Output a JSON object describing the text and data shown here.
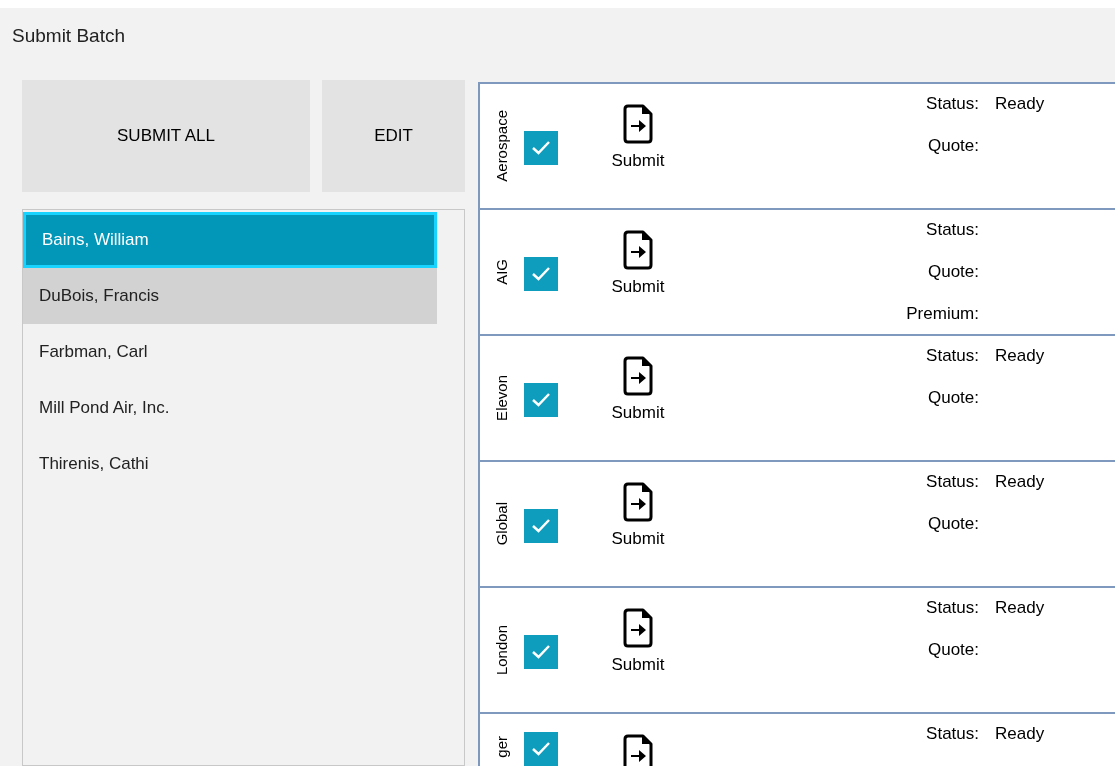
{
  "window": {
    "title": "Submit Batch"
  },
  "buttons": [
    {
      "label": "SUBMIT ALL"
    },
    {
      "label": "EDIT"
    }
  ],
  "clients": [
    {
      "name": "Bains, William",
      "selected": true,
      "hovered": false
    },
    {
      "name": "DuBois, Francis",
      "selected": false,
      "hovered": true
    },
    {
      "name": "Farbman, Carl",
      "selected": false,
      "hovered": false
    },
    {
      "name": "Mill Pond Air, Inc.",
      "selected": false,
      "hovered": false
    },
    {
      "name": "Thirenis, Cathi",
      "selected": false,
      "hovered": false
    }
  ],
  "carriers": [
    {
      "name": "Aerospace",
      "checked": true,
      "submit_label": "Submit",
      "fields": [
        {
          "label": "Status:",
          "value": "Ready"
        },
        {
          "label": "Quote:"
        }
      ]
    },
    {
      "name": "AIG",
      "checked": true,
      "submit_label": "Submit",
      "fields": [
        {
          "label": "Status:"
        },
        {
          "label": "Quote:"
        },
        {
          "label": "Premium:"
        }
      ]
    },
    {
      "name": "Elevon",
      "checked": true,
      "submit_label": "Submit",
      "fields": [
        {
          "label": "Status:",
          "value": "Ready"
        },
        {
          "label": "Quote:"
        }
      ]
    },
    {
      "name": "Global",
      "checked": true,
      "submit_label": "Submit",
      "fields": [
        {
          "label": "Status:",
          "value": "Ready"
        },
        {
          "label": "Quote:"
        }
      ]
    },
    {
      "name": "London",
      "checked": true,
      "submit_label": "Submit",
      "fields": [
        {
          "label": "Status:",
          "value": "Ready"
        },
        {
          "label": "Quote:"
        }
      ]
    },
    {
      "name": "ger",
      "checked": true,
      "fields": [
        {
          "label": "Status:",
          "value": "Ready"
        }
      ]
    }
  ]
}
